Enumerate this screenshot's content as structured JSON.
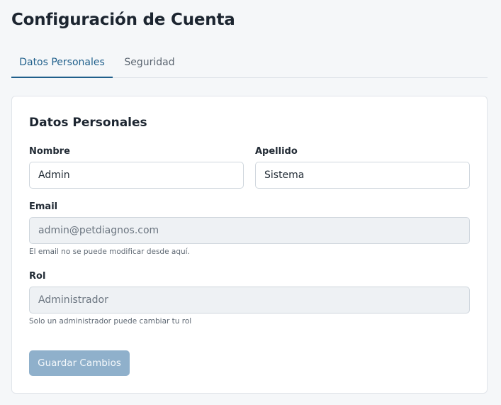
{
  "page": {
    "title": "Configuración de Cuenta"
  },
  "tabs": [
    {
      "label": "Datos Personales",
      "active": true
    },
    {
      "label": "Seguridad",
      "active": false
    }
  ],
  "form": {
    "section_title": "Datos Personales",
    "nombre": {
      "label": "Nombre",
      "value": "Admin"
    },
    "apellido": {
      "label": "Apellido",
      "value": "Sistema"
    },
    "email": {
      "label": "Email",
      "value": "admin@petdiagnos.com",
      "help": "El email no se puede modificar desde aquí."
    },
    "rol": {
      "label": "Rol",
      "value": "Administrador",
      "help": "Solo un administrador puede cambiar tu rol"
    },
    "save_label": "Guardar Cambios"
  },
  "colors": {
    "accent": "#1f5f8b",
    "button_disabled": "#8fb0cb",
    "page_background": "#f5f7f9"
  }
}
